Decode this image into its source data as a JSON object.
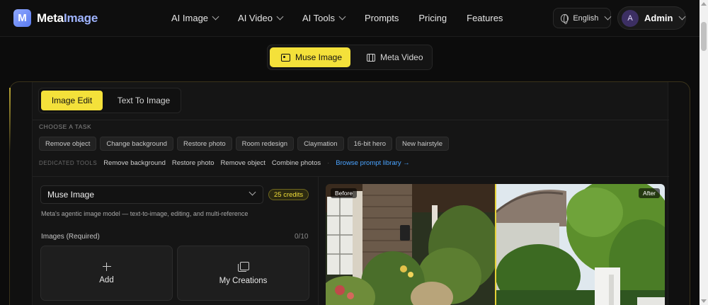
{
  "brand": {
    "name_part1": "Meta",
    "name_part2": "Image",
    "logo_letter": "M"
  },
  "nav": {
    "items": [
      {
        "label": "AI Image",
        "dropdown": true
      },
      {
        "label": "AI Video",
        "dropdown": true
      },
      {
        "label": "AI Tools",
        "dropdown": true
      },
      {
        "label": "Prompts",
        "dropdown": false
      },
      {
        "label": "Pricing",
        "dropdown": false
      },
      {
        "label": "Features",
        "dropdown": false
      }
    ]
  },
  "language": {
    "label": "English",
    "icon": "globe-icon"
  },
  "user": {
    "initial": "A",
    "name": "Admin"
  },
  "mode_switch": {
    "muse_label": "Muse Image",
    "video_label": "Meta Video",
    "active": "Muse Image"
  },
  "editor": {
    "tabs": {
      "image_edit": "Image Edit",
      "text_to_image": "Text To Image",
      "active": "Image Edit"
    },
    "task_label": "CHOOSE A TASK",
    "tasks": [
      "Remove object",
      "Change background",
      "Restore photo",
      "Room redesign",
      "Claymation",
      "16-bit hero",
      "New hairstyle"
    ],
    "dedicated_label": "DEDICATED TOOLS",
    "dedicated_tools": [
      "Remove background",
      "Restore photo",
      "Remove object",
      "Combine photos"
    ],
    "separator": "·",
    "browse_label": "Browse prompt library →"
  },
  "form": {
    "model_value": "Muse Image",
    "credits": "25 credits",
    "model_description": "Meta's agentic image model — text-to-image, editing, and multi-reference",
    "images_label": "Images (Required)",
    "images_count": "0/10",
    "add_label": "Add",
    "creations_label": "My Creations"
  },
  "preview": {
    "before_label": "Before",
    "after_label": "After"
  },
  "colors": {
    "accent_yellow": "#f4e13a",
    "link_blue": "#4aa3ff",
    "background": "#0c0c0c"
  }
}
